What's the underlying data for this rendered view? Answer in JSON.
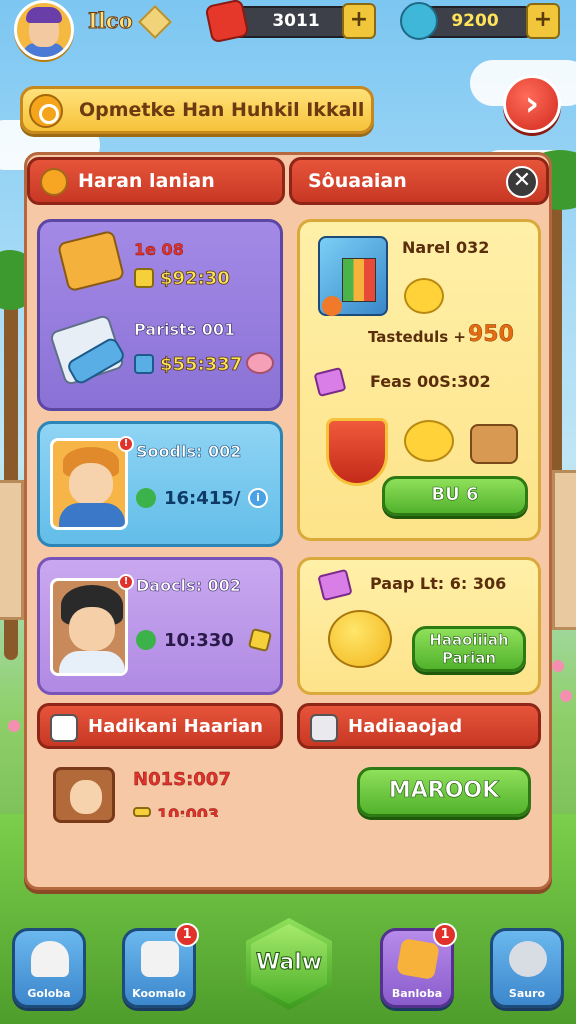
{
  "top_bar": {
    "player_name": "Ilco",
    "currencies": [
      {
        "value": "3011",
        "icon": "ticket-icon",
        "plus": "+"
      },
      {
        "value": "9200",
        "icon": "fish-coin-icon",
        "plus": "+"
      }
    ]
  },
  "quest_banner": {
    "text": "Opmetke Han Huhkil Ikkall",
    "next_icon": "chevron-right-icon",
    "next_symbol": "›"
  },
  "left_panel": {
    "title": "Haran lanian",
    "cards": [
      {
        "items": [
          {
            "count": "1e 08",
            "price": "$92:30"
          },
          {
            "count": "Parists 001",
            "price": "$55:337"
          }
        ]
      },
      {
        "name": "Soodls: 002",
        "price": "16:415/",
        "info": "i"
      },
      {
        "name": "Daocls: 002",
        "price": "10:330",
        "badge": "!"
      }
    ],
    "footer_title": "Hadikani Haarian",
    "footer_item": {
      "name": "N01S:007",
      "price": "10:003"
    }
  },
  "right_panel": {
    "title": "Sôuaaian",
    "close": "✕",
    "card1": {
      "name": "Narel 032",
      "tasted_label": "Tasteduls +",
      "tasted_value": "950",
      "feas": "Feas 00S:302",
      "buy": "BU 6"
    },
    "card2": {
      "name": "Paap Lt: 6: 306",
      "button": "Haaoiiiah Parian"
    },
    "footer_title": "Hadiaaojad",
    "footer_button": "MAROOK"
  },
  "bottom_nav": [
    {
      "label": "Goloba",
      "icon": "home-icon",
      "badge": ""
    },
    {
      "label": "Koomalo",
      "icon": "chat-icon",
      "badge": "1"
    },
    {
      "label": "Walw",
      "icon": "main-action",
      "badge": ""
    },
    {
      "label": "Banloba",
      "icon": "cards-icon",
      "badge": "1"
    },
    {
      "label": "Sauro",
      "icon": "pet-icon",
      "badge": ""
    }
  ],
  "colors": {
    "panel_bg": "#f7c8a6",
    "header_red": "#d63f2a",
    "button_green": "#52b22c"
  }
}
